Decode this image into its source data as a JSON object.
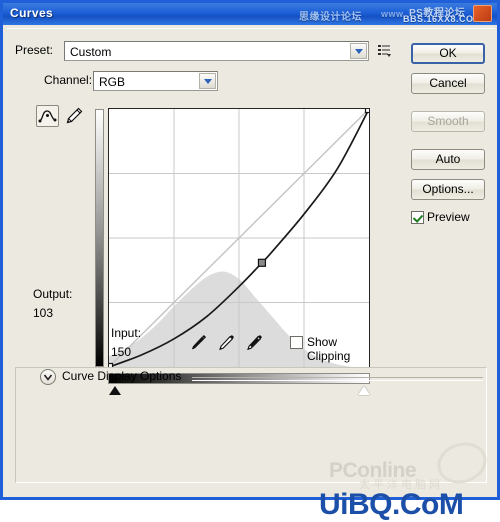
{
  "window": {
    "title": "Curves",
    "watermarks": {
      "title_cn": "思缘设计论坛",
      "title_www": "www.",
      "title_ps": "PS教程论坛",
      "title_bbs": "BBS.16XX8.COM",
      "bottom_pconline": "PConline",
      "bottom_pconline_cn": "太平洋电脑网",
      "bottom_uibq": "UiBQ.CoM"
    }
  },
  "preset": {
    "label": "Preset:",
    "value": "Custom",
    "menu_icon": "preset-menu-icon"
  },
  "channel": {
    "label": "Channel:",
    "value": "RGB"
  },
  "buttons": {
    "ok": "OK",
    "cancel": "Cancel",
    "smooth": "Smooth",
    "auto": "Auto",
    "options": "Options..."
  },
  "preview": {
    "label": "Preview",
    "checked": true
  },
  "tools": {
    "curve_icon": "curve-tool-icon",
    "pencil_icon": "pencil-tool-icon",
    "curve_selected": true
  },
  "readout": {
    "output_label": "Output:",
    "output_value": "103",
    "input_label": "Input:",
    "input_value": "150"
  },
  "eyedroppers": [
    {
      "name": "black-point-eyedropper"
    },
    {
      "name": "gray-point-eyedropper"
    },
    {
      "name": "white-point-eyedropper"
    }
  ],
  "show_clipping": {
    "label": "Show Clipping",
    "checked": false
  },
  "curve_display_options": {
    "label": "Curve Display Options",
    "expanded": false,
    "toggle_icon": "chevron-down-icon"
  },
  "colors": {
    "title_bar": "#1d5fd6",
    "dialog_bg": "#ece9e0",
    "frame": "#1f5fd8",
    "check": "#207a20",
    "curve": "#1a1a1a",
    "histogram": "#dcdcdc"
  },
  "chart_data": {
    "type": "line",
    "title": "Curves",
    "xlabel": "Input",
    "ylabel": "Output",
    "xlim": [
      0,
      255
    ],
    "ylim": [
      0,
      255
    ],
    "grid": true,
    "gridlines": 4,
    "legend": "none",
    "series": [
      {
        "name": "baseline-diagonal",
        "style": "light-gray-straight",
        "x": [
          0,
          255
        ],
        "y": [
          0,
          255
        ]
      },
      {
        "name": "rgb-curve",
        "style": "black-curve",
        "x": [
          0,
          32,
          64,
          96,
          128,
          150,
          160,
          192,
          224,
          255
        ],
        "y": [
          0,
          12,
          28,
          50,
          80,
          103,
          114,
          152,
          196,
          255
        ]
      }
    ],
    "control_points": [
      {
        "input": 0,
        "output": 0
      },
      {
        "input": 150,
        "output": 103
      },
      {
        "input": 255,
        "output": 255
      }
    ],
    "selected_point": {
      "input": 150,
      "output": 103
    },
    "histogram": {
      "name": "image-histogram",
      "x": [
        0,
        16,
        32,
        48,
        64,
        80,
        96,
        112,
        128,
        144,
        160,
        176,
        192,
        208,
        224,
        240,
        255
      ],
      "values": [
        8,
        14,
        22,
        33,
        46,
        58,
        68,
        72,
        66,
        52,
        38,
        24,
        13,
        6,
        2,
        0,
        0
      ]
    },
    "black_point_slider": 0,
    "white_point_slider": 255
  }
}
